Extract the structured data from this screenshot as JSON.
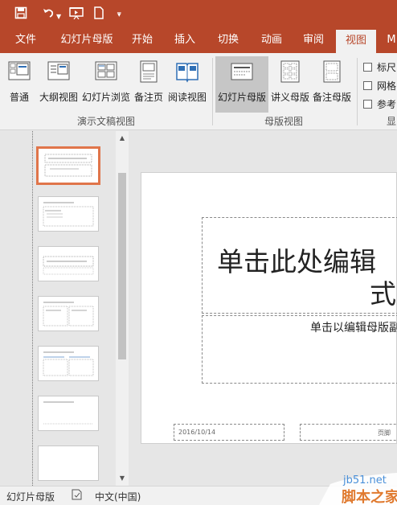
{
  "quick_access": {
    "save_icon": "save-icon",
    "undo_icon": "undo-icon",
    "undo_dropdown_icon": "dropdown-icon",
    "present_icon": "present-from-start-icon",
    "new_icon": "new-document-icon",
    "customize_icon": "customize-toolbar-icon"
  },
  "tabs": [
    {
      "label": "文件"
    },
    {
      "label": "幻灯片母版"
    },
    {
      "label": "开始"
    },
    {
      "label": "插入"
    },
    {
      "label": "切换"
    },
    {
      "label": "动画"
    },
    {
      "label": "审阅"
    },
    {
      "label": "视图"
    },
    {
      "label": "M"
    }
  ],
  "ribbon": {
    "presentation_views": {
      "label": "演示文稿视图",
      "buttons": [
        {
          "label": "普通"
        },
        {
          "label": "大纲视图"
        },
        {
          "label": "幻灯片浏览"
        },
        {
          "label": "备注页"
        },
        {
          "label": "阅读视图"
        }
      ]
    },
    "master_views": {
      "label": "母版视图",
      "buttons": [
        {
          "label": "幻灯片母版"
        },
        {
          "label": "讲义母版"
        },
        {
          "label": "备注母版"
        }
      ]
    },
    "show": {
      "label": "显",
      "checkboxes": [
        {
          "label": "标尺"
        },
        {
          "label": "网格"
        },
        {
          "label": "参考"
        }
      ]
    }
  },
  "slide": {
    "title_line1": "单击此处编辑",
    "title_line2": "式",
    "subtitle": "单击以编辑母版副",
    "date": "2016/10/14",
    "footer": "页脚"
  },
  "status_bar": {
    "view_name": "幻灯片母版",
    "language": "中文(中国)"
  },
  "watermark": {
    "url": "jb51.net",
    "text": "脚本之家"
  },
  "colors": {
    "accent": "#b7472a",
    "ribbon_bg": "#f1f1f1",
    "selected_thumb_border": "#e0754a"
  }
}
